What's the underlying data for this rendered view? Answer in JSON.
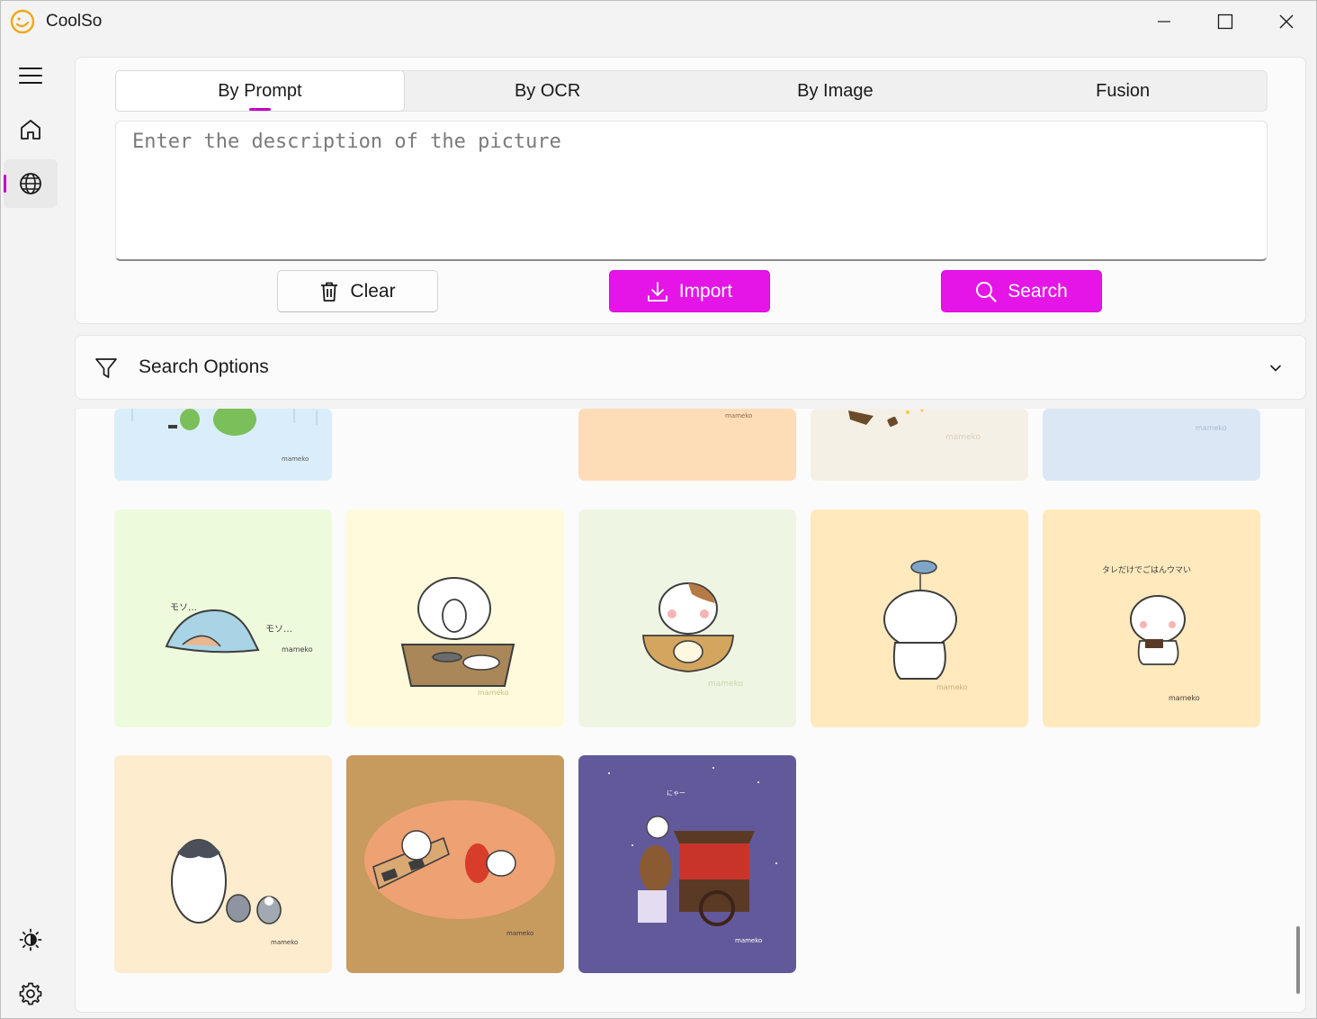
{
  "app": {
    "title": "CoolSo"
  },
  "window_controls": {
    "minimize": "minimize",
    "maximize": "maximize",
    "close": "close"
  },
  "sidebar": {
    "items": [
      {
        "name": "menu",
        "icon": "hamburger-menu-icon"
      },
      {
        "name": "home",
        "icon": "home-icon"
      },
      {
        "name": "web-search",
        "icon": "globe-icon",
        "active": true
      }
    ],
    "bottom": [
      {
        "name": "theme",
        "icon": "brightness-icon"
      },
      {
        "name": "settings",
        "icon": "gear-icon"
      }
    ]
  },
  "tabs": [
    {
      "label": "By Prompt",
      "active": true
    },
    {
      "label": "By OCR"
    },
    {
      "label": "By Image"
    },
    {
      "label": "Fusion"
    }
  ],
  "prompt": {
    "placeholder": "Enter the description of the picture",
    "value": ""
  },
  "actions": {
    "clear": "Clear",
    "import": "Import",
    "search": "Search"
  },
  "search_options": {
    "label": "Search Options"
  },
  "colors": {
    "accent": "#e415e6",
    "indicator": "#c400c8"
  },
  "gallery": {
    "rows": [
      [
        {
          "name": "frogs-in-rain",
          "bg": "#d9eefa",
          "watermark": "mameko"
        },
        {
          "name": "empty",
          "bg": "#fbfbfb"
        },
        {
          "name": "peach-card",
          "bg": "#fddcb8",
          "watermark": "mameko"
        },
        {
          "name": "beige-card",
          "bg": "#f5f0e6",
          "watermark": "mameko"
        },
        {
          "name": "blue-card",
          "bg": "#dbe7f5",
          "watermark": "mameko"
        }
      ],
      [
        {
          "name": "blanket-sleeping",
          "bg": "#eefadc",
          "caption": "モソ…",
          "watermark": "mameko"
        },
        {
          "name": "cat-at-table",
          "bg": "#fffadb",
          "watermark": "mameko"
        },
        {
          "name": "calico-cat-eating",
          "bg": "#eff5e3",
          "watermark": "mameko"
        },
        {
          "name": "cat-with-fish",
          "bg": "#ffe9bd",
          "watermark": "mameko"
        },
        {
          "name": "cat-rice-delicious",
          "bg": "#ffe9bd",
          "caption": "タレだけでごはんウマい",
          "watermark": "mameko"
        }
      ],
      [
        {
          "name": "penguin-family",
          "bg": "#fdeccd",
          "watermark": "mameko"
        },
        {
          "name": "cats-grilling",
          "bg": "#c79a5e",
          "watermark": "mameko"
        },
        {
          "name": "ramen-cart-night",
          "bg": "#62599b",
          "caption": "にゃー",
          "watermark": "mameko"
        }
      ]
    ]
  }
}
